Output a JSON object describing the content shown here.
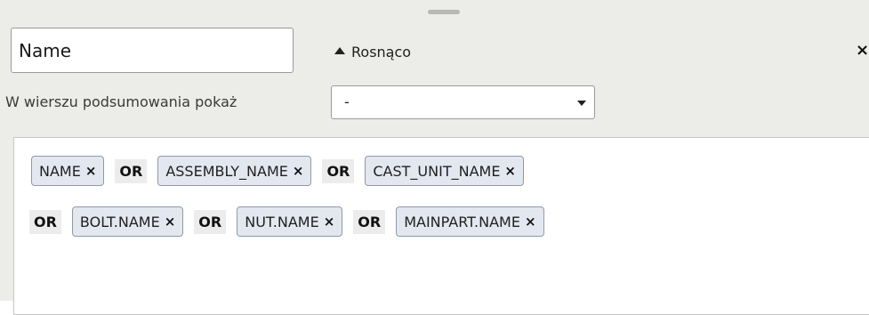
{
  "panel": {
    "name_field": {
      "value": "Name"
    },
    "sort": {
      "label": "Rosnąco",
      "direction_icon": "triangle-up-icon"
    },
    "close": {
      "label": "×",
      "icon": "close-icon"
    },
    "summary": {
      "label": "W wierszu podsumowania pokaż",
      "selected": "-"
    },
    "filter": {
      "rows": [
        [
          {
            "type": "chip",
            "label": "NAME",
            "remove": "×"
          },
          {
            "type": "op",
            "label": "OR"
          },
          {
            "type": "chip",
            "label": "ASSEMBLY_NAME",
            "remove": "×"
          },
          {
            "type": "op",
            "label": "OR"
          },
          {
            "type": "chip",
            "label": "CAST_UNIT_NAME",
            "remove": "×"
          }
        ],
        [
          {
            "type": "op",
            "label": "OR"
          },
          {
            "type": "chip",
            "label": "BOLT.NAME",
            "remove": "×"
          },
          {
            "type": "op",
            "label": "OR"
          },
          {
            "type": "chip",
            "label": "NUT.NAME",
            "remove": "×"
          },
          {
            "type": "op",
            "label": "OR"
          },
          {
            "type": "chip",
            "label": "MAINPART.NAME",
            "remove": "×"
          }
        ]
      ]
    }
  }
}
